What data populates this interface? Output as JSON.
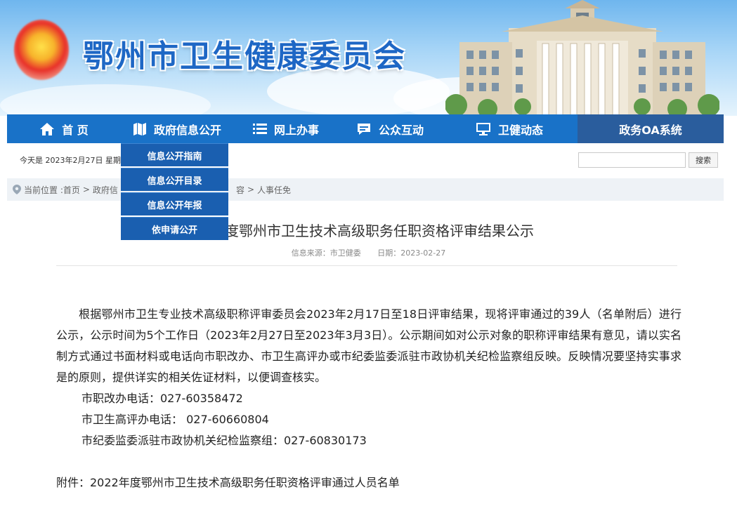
{
  "header": {
    "site_title": "鄂州市卫生健康委员会"
  },
  "nav": {
    "items": [
      {
        "label": "首 页",
        "icon": "home-icon"
      },
      {
        "label": "政府信息公开",
        "icon": "map-book-icon"
      },
      {
        "label": "网上办事",
        "icon": "list-icon"
      },
      {
        "label": "公众互动",
        "icon": "chat-icon"
      },
      {
        "label": "卫健动态",
        "icon": "monitor-icon"
      },
      {
        "label": "政务OA系统",
        "icon": ""
      }
    ],
    "dropdown": [
      "信息公开指南",
      "信息公开目录",
      "信息公开年报",
      "依申请公开"
    ]
  },
  "topbar": {
    "date_text": "今天是 2023年2月27日 星期",
    "search_placeholder": "",
    "search_button": "搜索"
  },
  "breadcrumb": {
    "prefix": "当前位置 :首页",
    "sep": ">",
    "part2": "政府信",
    "part3": "容",
    "last": "人事任免"
  },
  "article": {
    "title": "年度鄂州市卫生技术高级职务任职资格评审结果公示",
    "source": "信息来源：市卫健委",
    "date": "日期：2023-02-27",
    "paragraph": "根据鄂州市卫生专业技术高级职称评审委员会2023年2月17日至18日评审结果，现将评审通过的39人（名单附后）进行公示，公示时间为5个工作日（2023年2月27日至2023年3月3日）。公示期间如对公示对象的职称评审结果有意见，请以实名制方式通过书面材料或电话向市职改办、市卫生高评办或市纪委监委派驻市政协机关纪检监察组反映。反映情况要坚持实事求是的原则，提供详实的相关佐证材料，以便调查核实。",
    "phone1": "市职改办电话：027-60358472",
    "phone2": "市卫生高评办电话： 027-60660804",
    "phone3": "市纪委监委派驻市政协机关纪检监察组：027-60830173",
    "attachment": "附件：2022年度鄂州市卫生技术高级职务任职资格评审通过人员名单"
  }
}
